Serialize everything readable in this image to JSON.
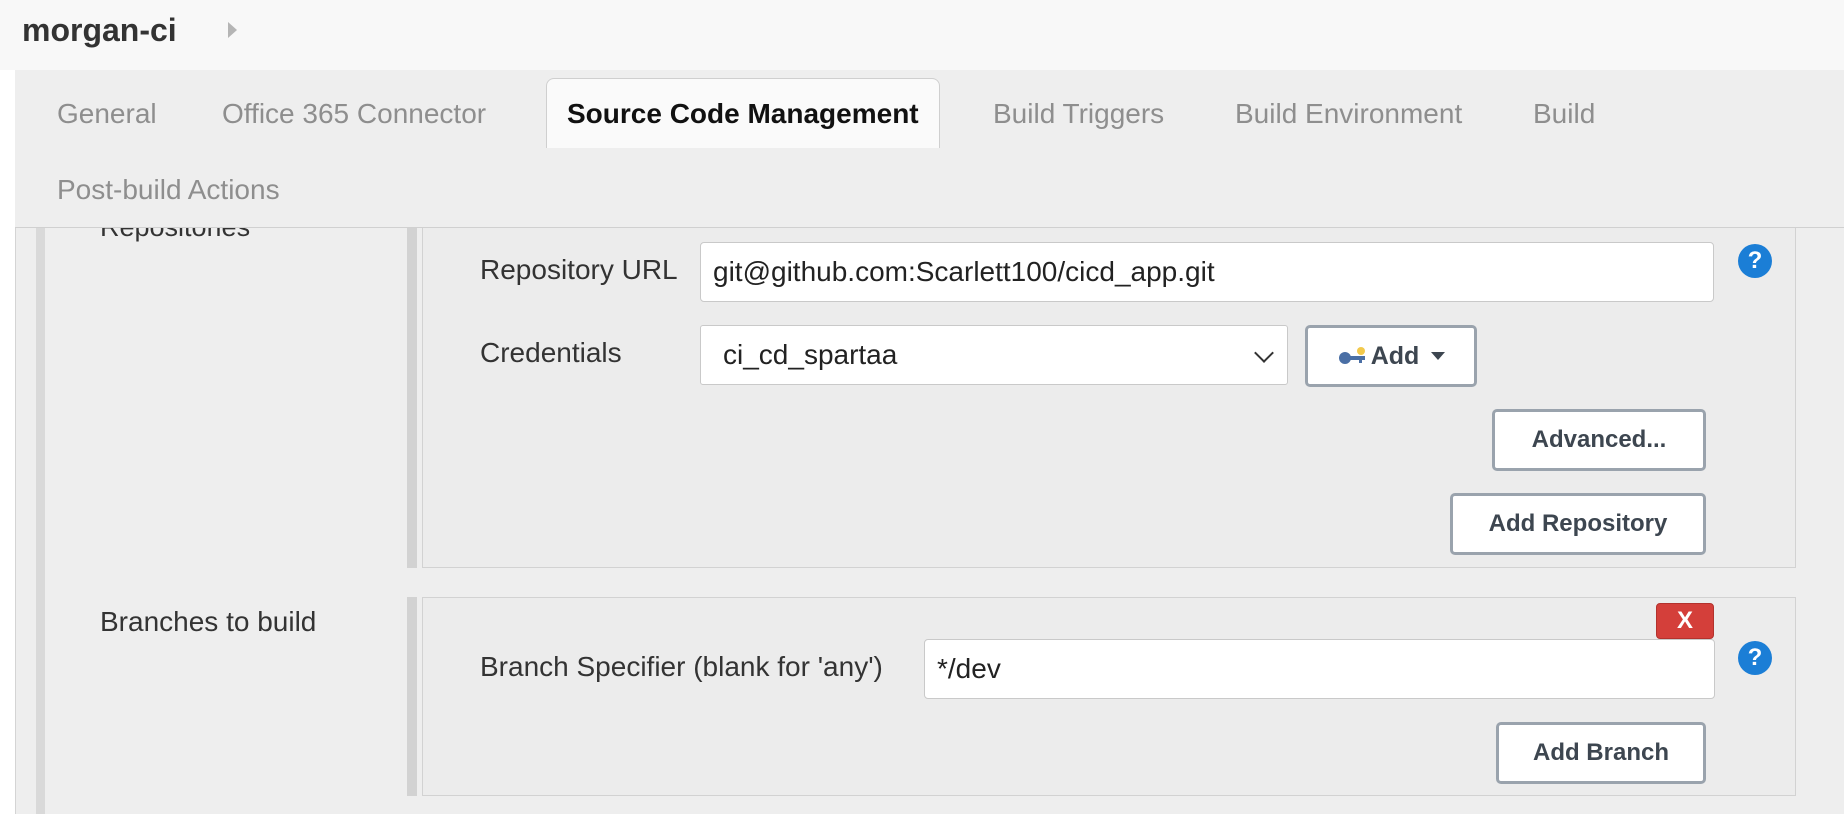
{
  "app": {
    "title": "morgan-ci"
  },
  "tabs": [
    {
      "label": "General",
      "active": false
    },
    {
      "label": "Office 365 Connector",
      "active": false
    },
    {
      "label": "Source Code Management",
      "active": true
    },
    {
      "label": "Build Triggers",
      "active": false
    },
    {
      "label": "Build Environment",
      "active": false
    },
    {
      "label": "Build",
      "active": false
    },
    {
      "label": "Post-build Actions",
      "active": false
    }
  ],
  "repositories": {
    "section_label": "Repositories",
    "url_label": "Repository URL",
    "url_value": "git@github.com:Scarlett100/cicd_app.git",
    "credentials_label": "Credentials",
    "credentials_value": "ci_cd_spartaa",
    "add_label": "Add",
    "advanced_label": "Advanced...",
    "add_repository_label": "Add Repository",
    "help": "?"
  },
  "branches": {
    "section_label": "Branches to build",
    "delete_label": "X",
    "specifier_label": "Branch Specifier (blank for 'any')",
    "specifier_value": "*/dev",
    "add_branch_label": "Add Branch",
    "help": "?"
  },
  "colors": {
    "help_blue": "#1b7ed6",
    "delete_red": "#d43f3a",
    "button_border": "#9aa3ad"
  }
}
